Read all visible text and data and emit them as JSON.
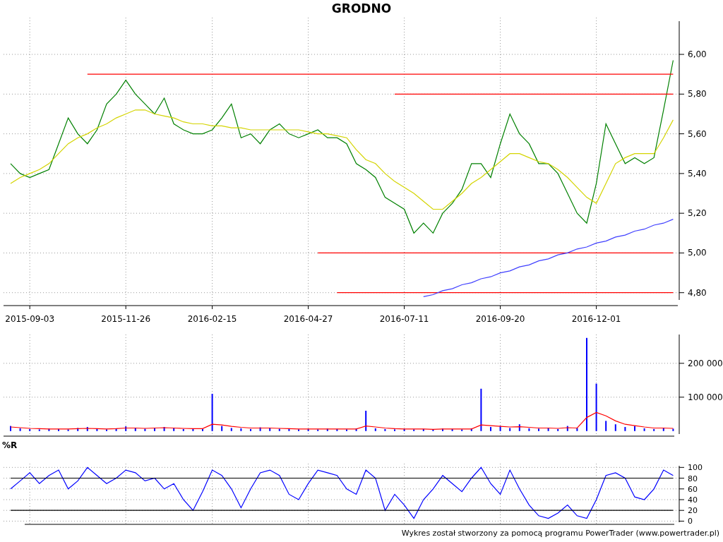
{
  "title": "GRODNO",
  "price_chart": {
    "chart_data": {
      "type": "line",
      "categories": [
        null,
        null,
        "2015-09-03",
        null,
        null,
        null,
        null,
        null,
        null,
        null,
        null,
        null,
        "2015-11-26",
        null,
        null,
        null,
        null,
        null,
        null,
        null,
        null,
        "2016-02-15",
        null,
        null,
        null,
        null,
        null,
        null,
        null,
        null,
        null,
        "2016-04-27",
        null,
        null,
        null,
        null,
        null,
        null,
        null,
        null,
        null,
        "2016-07-11",
        null,
        null,
        null,
        null,
        null,
        null,
        null,
        null,
        null,
        "2016-09-20",
        null,
        null,
        null,
        null,
        null,
        null,
        null,
        null,
        null,
        "2016-12-01",
        null,
        null,
        null,
        null,
        null,
        null,
        null,
        null
      ],
      "series": [
        {
          "color": "#008000",
          "values": [
            5.45,
            5.4,
            5.38,
            5.4,
            5.42,
            5.55,
            5.68,
            5.6,
            5.55,
            5.62,
            5.75,
            5.8,
            5.87,
            5.8,
            5.75,
            5.7,
            5.78,
            5.65,
            5.62,
            5.6,
            5.6,
            5.62,
            5.68,
            5.75,
            5.58,
            5.6,
            5.55,
            5.62,
            5.65,
            5.6,
            5.58,
            5.6,
            5.62,
            5.58,
            5.58,
            5.55,
            5.45,
            5.42,
            5.38,
            5.28,
            5.25,
            5.22,
            5.1,
            5.15,
            5.1,
            5.2,
            5.25,
            5.32,
            5.45,
            5.45,
            5.38,
            5.55,
            5.7,
            5.6,
            5.55,
            5.45,
            5.45,
            5.4,
            5.3,
            5.2,
            5.15,
            5.35,
            5.65,
            5.55,
            5.45,
            5.48,
            5.45,
            5.48,
            5.72,
            5.97
          ]
        },
        {
          "color": "#d4d400",
          "values": [
            5.35,
            5.38,
            5.4,
            5.42,
            5.45,
            5.5,
            5.55,
            5.58,
            5.6,
            5.63,
            5.65,
            5.68,
            5.7,
            5.72,
            5.72,
            5.7,
            5.69,
            5.68,
            5.66,
            5.65,
            5.65,
            5.64,
            5.64,
            5.63,
            5.63,
            5.62,
            5.62,
            5.62,
            5.62,
            5.62,
            5.62,
            5.61,
            5.6,
            5.6,
            5.59,
            5.58,
            5.52,
            5.47,
            5.45,
            5.4,
            5.36,
            5.33,
            5.3,
            5.26,
            5.22,
            5.22,
            5.26,
            5.3,
            5.35,
            5.38,
            5.42,
            5.46,
            5.5,
            5.5,
            5.48,
            5.46,
            5.45,
            5.42,
            5.38,
            5.33,
            5.28,
            5.25,
            5.35,
            5.45,
            5.48,
            5.5,
            5.5,
            5.5,
            5.58,
            5.67
          ]
        },
        {
          "color": "#ff0000",
          "values": [
            null,
            null,
            null,
            null,
            null,
            null,
            null,
            null,
            5.9,
            5.9,
            5.9,
            5.9,
            5.9,
            5.9,
            5.9,
            5.9,
            5.9,
            5.9,
            5.9,
            5.9,
            5.9,
            5.9,
            5.9,
            5.9,
            5.9,
            5.9,
            5.9,
            5.9,
            5.9,
            5.9,
            5.9,
            5.9,
            5.9,
            5.9,
            5.9,
            5.9,
            5.9,
            5.9,
            5.9,
            5.9,
            5.9,
            5.9,
            5.9,
            5.9,
            5.9,
            5.9,
            5.9,
            5.9,
            5.9,
            5.9,
            5.9,
            5.9,
            5.9,
            5.9,
            5.9,
            5.9,
            5.9,
            5.9,
            5.9,
            5.9,
            5.9,
            5.9,
            5.9,
            5.9,
            5.9,
            5.9,
            5.9,
            5.9,
            5.9,
            5.9
          ]
        },
        {
          "color": "#ff0000",
          "values": [
            null,
            null,
            null,
            null,
            null,
            null,
            null,
            null,
            null,
            null,
            null,
            null,
            null,
            null,
            null,
            null,
            null,
            null,
            null,
            null,
            null,
            null,
            null,
            null,
            null,
            null,
            null,
            null,
            null,
            null,
            null,
            null,
            null,
            null,
            null,
            null,
            null,
            null,
            null,
            null,
            5.8,
            5.8,
            5.8,
            5.8,
            5.8,
            5.8,
            5.8,
            5.8,
            5.8,
            5.8,
            5.8,
            5.8,
            5.8,
            5.8,
            5.8,
            5.8,
            5.8,
            5.8,
            5.8,
            5.8,
            5.8,
            5.8,
            5.8,
            5.8,
            5.8,
            5.8,
            5.8,
            5.8,
            5.8,
            5.8
          ]
        },
        {
          "color": "#ff0000",
          "values": [
            null,
            null,
            null,
            null,
            null,
            null,
            null,
            null,
            null,
            null,
            null,
            null,
            null,
            null,
            null,
            null,
            null,
            null,
            null,
            null,
            null,
            null,
            null,
            null,
            null,
            null,
            null,
            null,
            null,
            null,
            null,
            null,
            5.0,
            5.0,
            5.0,
            5.0,
            5.0,
            5.0,
            5.0,
            5.0,
            5.0,
            5.0,
            5.0,
            5.0,
            5.0,
            5.0,
            5.0,
            5.0,
            5.0,
            5.0,
            5.0,
            5.0,
            5.0,
            5.0,
            5.0,
            5.0,
            5.0,
            5.0,
            5.0,
            5.0,
            5.0,
            5.0,
            5.0,
            5.0,
            5.0,
            5.0,
            5.0,
            5.0,
            5.0,
            5.0
          ]
        },
        {
          "color": "#ff0000",
          "values": [
            null,
            null,
            null,
            null,
            null,
            null,
            null,
            null,
            null,
            null,
            null,
            null,
            null,
            null,
            null,
            null,
            null,
            null,
            null,
            null,
            null,
            null,
            null,
            null,
            null,
            null,
            null,
            null,
            null,
            null,
            null,
            null,
            null,
            null,
            4.8,
            4.8,
            4.8,
            4.8,
            4.8,
            4.8,
            4.8,
            4.8,
            4.8,
            4.8,
            4.8,
            4.8,
            4.8,
            4.8,
            4.8,
            4.8,
            4.8,
            4.8,
            4.8,
            4.8,
            4.8,
            4.8,
            4.8,
            4.8,
            4.8,
            4.8,
            4.8,
            4.8,
            4.8,
            4.8,
            4.8,
            4.8,
            4.8,
            4.8,
            4.8,
            4.8
          ]
        },
        {
          "color": "#4040ff",
          "values": [
            null,
            null,
            null,
            null,
            null,
            null,
            null,
            null,
            null,
            null,
            null,
            null,
            null,
            null,
            null,
            null,
            null,
            null,
            null,
            null,
            null,
            null,
            null,
            null,
            null,
            null,
            null,
            null,
            null,
            null,
            null,
            null,
            null,
            null,
            null,
            null,
            null,
            null,
            null,
            null,
            null,
            null,
            null,
            4.78,
            4.79,
            4.81,
            4.82,
            4.84,
            4.85,
            4.87,
            4.88,
            4.9,
            4.91,
            4.93,
            4.94,
            4.96,
            4.97,
            4.99,
            5.0,
            5.02,
            5.03,
            5.05,
            5.06,
            5.08,
            5.09,
            5.11,
            5.12,
            5.14,
            5.15,
            5.17
          ]
        }
      ],
      "ylim": [
        4.735,
        6.185
      ],
      "yticks": [
        {
          "value": 6.0,
          "label": "6,00"
        },
        {
          "value": 5.8,
          "label": "5,80"
        },
        {
          "value": 5.6,
          "label": "5,60"
        },
        {
          "value": 5.4,
          "label": "5,40"
        },
        {
          "value": 5.2,
          "label": "5,20"
        },
        {
          "value": 5.0,
          "label": "5,00"
        },
        {
          "value": 4.8,
          "label": "4,80"
        }
      ],
      "grid": true
    }
  },
  "volume_chart": {
    "chart_data": {
      "type": "bar",
      "categories": [
        null,
        null,
        null,
        null,
        null,
        null,
        null,
        null,
        null,
        null,
        null,
        null,
        null,
        null,
        null,
        null,
        null,
        null,
        null,
        null,
        null,
        null,
        null,
        null,
        null,
        null,
        null,
        null,
        null,
        null,
        null,
        null,
        null,
        null,
        null,
        null,
        null,
        null,
        null,
        null,
        null,
        null,
        null,
        null,
        null,
        null,
        null,
        null,
        null,
        null,
        null,
        null,
        null,
        null,
        null,
        null,
        null,
        null,
        null,
        null,
        null,
        null,
        null,
        null,
        null,
        null,
        null,
        null,
        null,
        null
      ],
      "series": [
        {
          "color": "#0000ff",
          "values": [
            15000,
            8000,
            6000,
            5000,
            7000,
            6000,
            5000,
            9000,
            12000,
            6000,
            5000,
            8000,
            14000,
            9000,
            7000,
            10000,
            12000,
            8000,
            6000,
            7000,
            6000,
            110000,
            15000,
            9000,
            8000,
            6000,
            11000,
            9000,
            7000,
            6000,
            5000,
            6000,
            5000,
            7000,
            6000,
            5000,
            7000,
            60000,
            8000,
            6000,
            5000,
            6000,
            5000,
            6000,
            5000,
            7000,
            6000,
            5000,
            8000,
            125000,
            12000,
            15000,
            9000,
            20000,
            8000,
            7000,
            9000,
            6000,
            15000,
            9000,
            275000,
            140000,
            30000,
            20000,
            12000,
            15000,
            8000,
            6000,
            9000,
            7000
          ]
        },
        {
          "type": "line",
          "color": "#ff0000",
          "values": [
            12000,
            10000,
            8000,
            7000,
            6000,
            6000,
            6000,
            7000,
            8000,
            7000,
            6000,
            7000,
            9000,
            9000,
            8000,
            9000,
            10000,
            9000,
            8000,
            7000,
            7000,
            20000,
            18000,
            14000,
            11000,
            9000,
            9000,
            9000,
            8000,
            7000,
            6000,
            6000,
            6000,
            6000,
            6000,
            6000,
            6000,
            15000,
            12000,
            9000,
            7000,
            6000,
            6000,
            6000,
            5000,
            6000,
            6000,
            6000,
            6000,
            18000,
            16000,
            14000,
            12000,
            13000,
            11000,
            9000,
            9000,
            8000,
            10000,
            9000,
            40000,
            55000,
            45000,
            30000,
            20000,
            16000,
            12000,
            9000,
            9000,
            8000
          ]
        }
      ],
      "ylim": [
        -15000,
        285000
      ],
      "yticks": [
        {
          "value": 100000,
          "label": "100 000"
        },
        {
          "value": 200000,
          "label": "200 000"
        }
      ],
      "grid": true
    }
  },
  "williams_chart": {
    "label": "%R",
    "chart_data": {
      "type": "line",
      "categories": [
        null,
        null,
        null,
        null,
        null,
        null,
        null,
        null,
        null,
        null,
        null,
        null,
        null,
        null,
        null,
        null,
        null,
        null,
        null,
        null,
        null,
        null,
        null,
        null,
        null,
        null,
        null,
        null,
        null,
        null,
        null,
        null,
        null,
        null,
        null,
        null,
        null,
        null,
        null,
        null,
        null,
        null,
        null,
        null,
        null,
        null,
        null,
        null,
        null,
        null,
        null,
        null,
        null,
        null,
        null,
        null,
        null,
        null,
        null,
        null,
        null,
        null,
        null,
        null,
        null,
        null,
        null,
        null,
        null,
        null
      ],
      "series": [
        {
          "color": "#0000ff",
          "values": [
            60,
            75,
            90,
            70,
            85,
            95,
            60,
            75,
            100,
            85,
            70,
            80,
            95,
            90,
            75,
            80,
            60,
            70,
            40,
            20,
            55,
            95,
            85,
            60,
            25,
            60,
            90,
            95,
            85,
            50,
            40,
            70,
            95,
            90,
            85,
            60,
            50,
            95,
            80,
            20,
            50,
            30,
            5,
            40,
            60,
            85,
            70,
            55,
            80,
            100,
            70,
            50,
            95,
            60,
            30,
            10,
            5,
            15,
            30,
            10,
            5,
            40,
            85,
            90,
            80,
            45,
            40,
            60,
            95,
            85
          ]
        },
        {
          "color": "#000000",
          "values": [
            80,
            80,
            80,
            80,
            80,
            80,
            80,
            80,
            80,
            80,
            80,
            80,
            80,
            80,
            80,
            80,
            80,
            80,
            80,
            80,
            80,
            80,
            80,
            80,
            80,
            80,
            80,
            80,
            80,
            80,
            80,
            80,
            80,
            80,
            80,
            80,
            80,
            80,
            80,
            80,
            80,
            80,
            80,
            80,
            80,
            80,
            80,
            80,
            80,
            80,
            80,
            80,
            80,
            80,
            80,
            80,
            80,
            80,
            80,
            80,
            80,
            80,
            80,
            80,
            80,
            80,
            80,
            80,
            80,
            80
          ]
        },
        {
          "color": "#000000",
          "values": [
            20,
            20,
            20,
            20,
            20,
            20,
            20,
            20,
            20,
            20,
            20,
            20,
            20,
            20,
            20,
            20,
            20,
            20,
            20,
            20,
            20,
            20,
            20,
            20,
            20,
            20,
            20,
            20,
            20,
            20,
            20,
            20,
            20,
            20,
            20,
            20,
            20,
            20,
            20,
            20,
            20,
            20,
            20,
            20,
            20,
            20,
            20,
            20,
            20,
            20,
            20,
            20,
            20,
            20,
            20,
            20,
            20,
            20,
            20,
            20,
            20,
            20,
            20,
            20,
            20,
            20,
            20,
            20,
            20,
            20
          ]
        }
      ],
      "ylim": [
        -6,
        107
      ],
      "yticks": [
        0,
        20,
        40,
        60,
        80,
        100
      ],
      "grid": true
    }
  },
  "footer": "Wykres został stworzony za pomocą programu PowerTrader (www.powertrader.pl)"
}
